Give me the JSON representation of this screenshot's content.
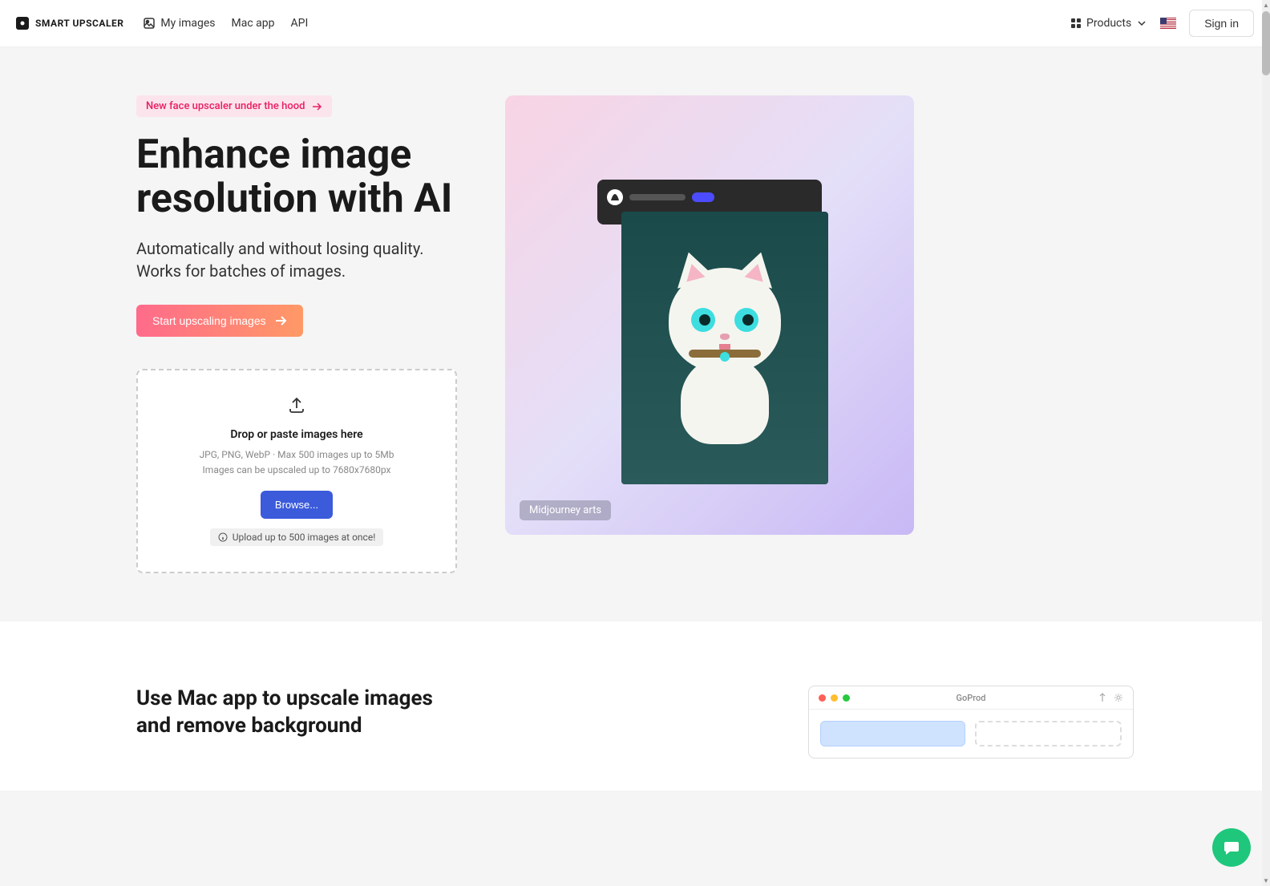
{
  "header": {
    "logo": "SMART UPSCALER",
    "nav": {
      "my_images": "My images",
      "mac_app": "Mac app",
      "api": "API"
    },
    "products": "Products",
    "signin": "Sign in"
  },
  "hero": {
    "badge": "New face upscaler under the hood",
    "title": "Enhance image resolution with AI",
    "desc": "Automatically and without losing quality. Works for batches of images.",
    "cta": "Start upscaling images"
  },
  "dropzone": {
    "title": "Drop or paste images here",
    "sub1": "JPG, PNG, WebP · Max 500 images up to 5Mb",
    "sub2": "Images can be upscaled up to 7680x7680px",
    "browse": "Browse...",
    "tip": "Upload up to 500 images at once!"
  },
  "showcase": {
    "tag": "Midjourney arts"
  },
  "mac_section": {
    "title": "Use Mac app to upscale images and remove background",
    "window_title": "GoProd"
  }
}
